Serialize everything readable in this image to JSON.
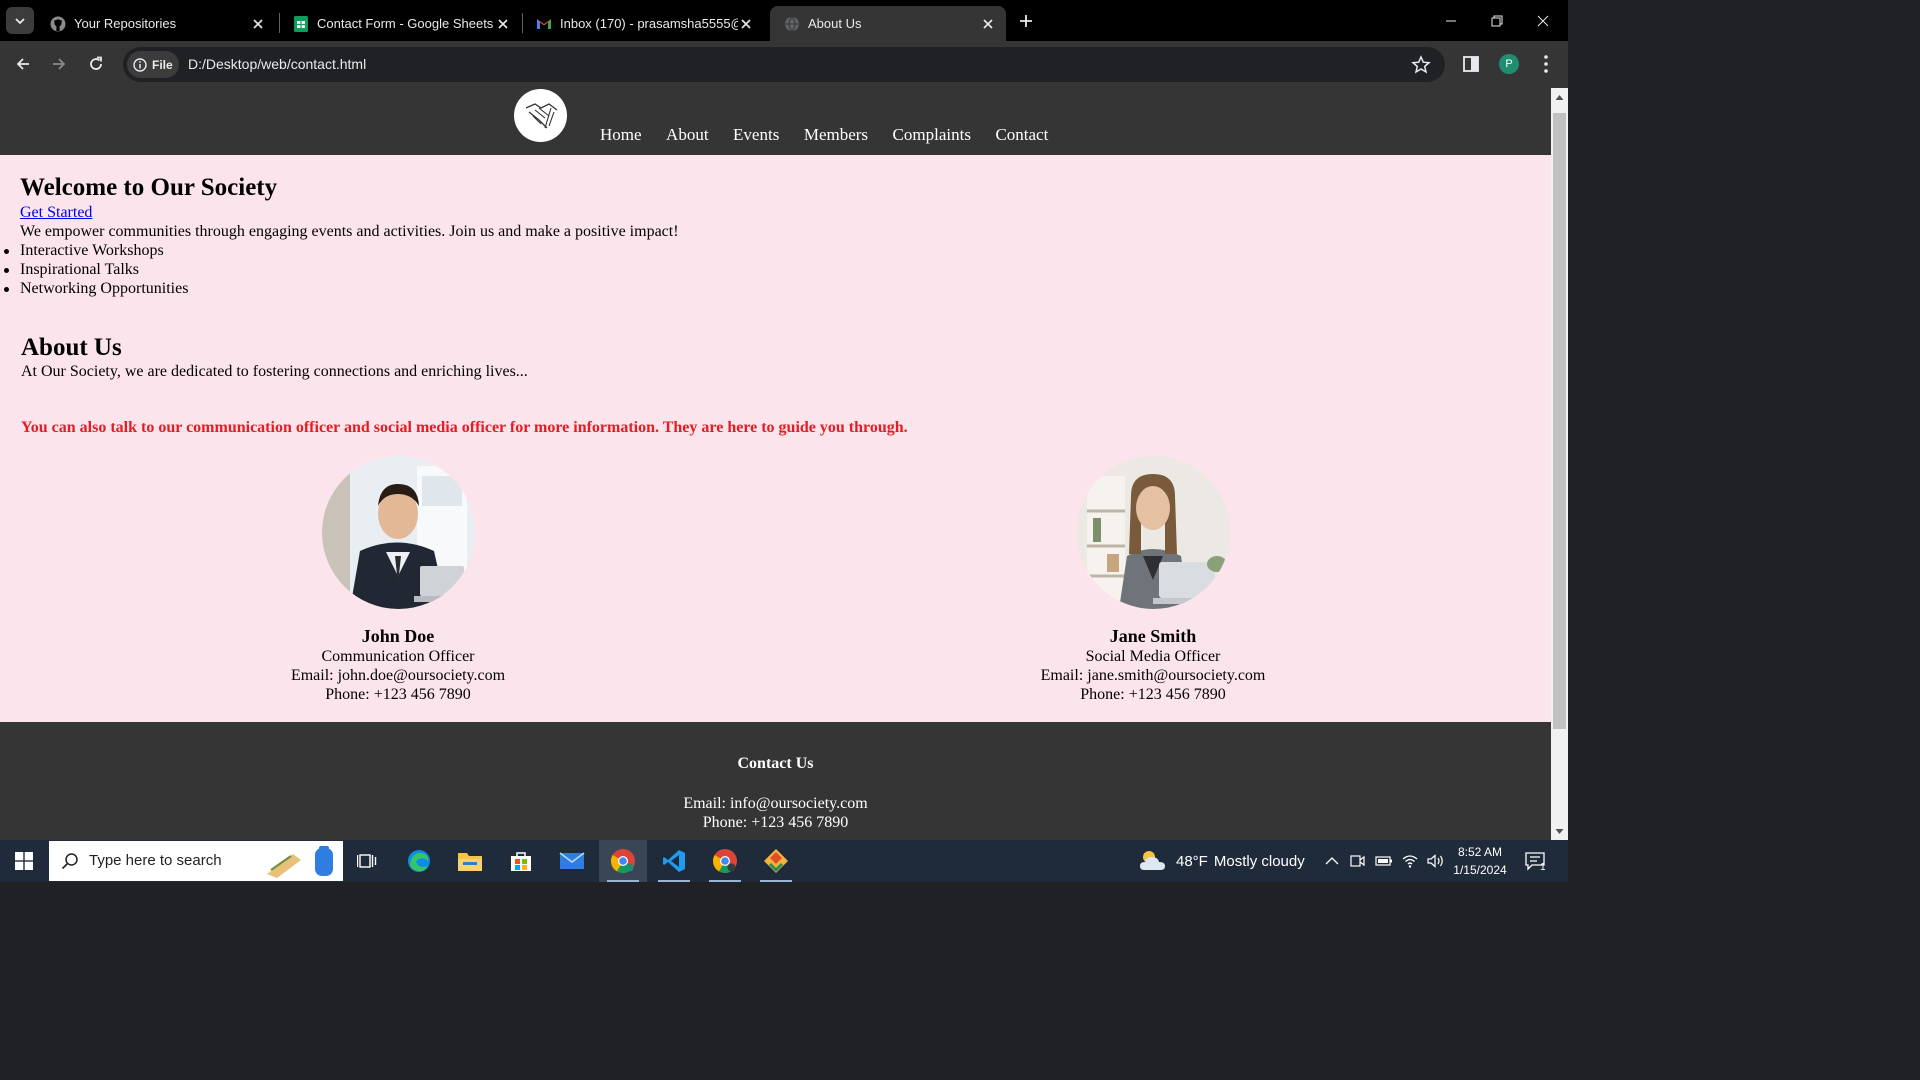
{
  "browser": {
    "tabs": [
      {
        "title": "Your Repositories",
        "icon": "github-icon"
      },
      {
        "title": "Contact Form - Google Sheets",
        "icon": "sheets-icon"
      },
      {
        "title": "Inbox (170) - prasamsha5555@",
        "icon": "gmail-icon"
      },
      {
        "title": "About Us",
        "icon": "globe-icon",
        "active": true
      }
    ],
    "address_chip": "File",
    "url": "D:/Desktop/web/contact.html",
    "profile_initial": "P"
  },
  "site": {
    "nav": [
      "Home",
      "About",
      "Events",
      "Members",
      "Complaints",
      "Contact"
    ],
    "hero": {
      "title": "Welcome to Our Society",
      "cta": "Get Started",
      "lead": "We empower communities through engaging events and activities. Join us and make a positive impact!",
      "features": [
        "Interactive Workshops",
        "Inspirational Talks",
        "Networking Opportunities"
      ]
    },
    "about": {
      "title": "About Us",
      "text": "At Our Society, we are dedicated to fostering connections and enriching lives...",
      "note": "You can also talk to our communication officer and social media officer for more information. They are here to guide you through."
    },
    "members": [
      {
        "name": "John Doe",
        "role": "Communication Officer",
        "email": "Email: john.doe@oursociety.com",
        "phone": "Phone: +123 456 7890"
      },
      {
        "name": "Jane Smith",
        "role": "Social Media Officer",
        "email": "Email: jane.smith@oursociety.com",
        "phone": "Phone: +123 456 7890"
      }
    ],
    "footer": {
      "title": "Contact Us",
      "email": "Email: info@oursociety.com",
      "phone": "Phone: +123 456 7890"
    },
    "colors": {
      "header": "#353535",
      "background": "#fce4ec",
      "note": "#e51c23"
    }
  },
  "taskbar": {
    "search_placeholder": "Type here to search",
    "weather_temp": "48°F",
    "weather_text": "Mostly cloudy",
    "time": "8:52 AM",
    "date": "1/15/2024",
    "notifications": "1"
  }
}
